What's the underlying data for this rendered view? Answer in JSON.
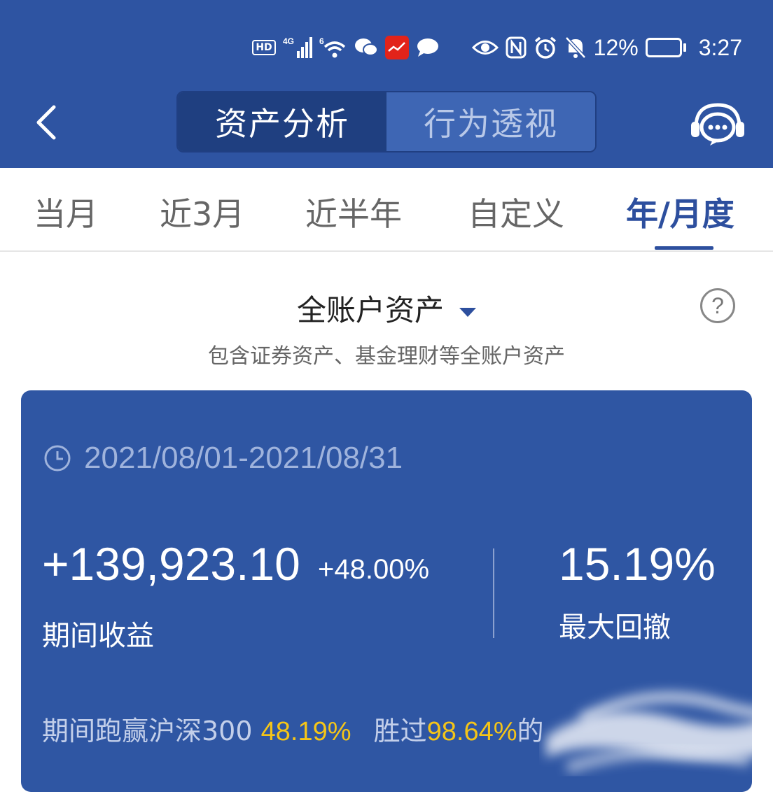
{
  "status_bar": {
    "hd": "HD",
    "network": "4G",
    "wifi_gen": "6",
    "battery_percent": "12%",
    "time": "3:27",
    "battery_level": 0.12,
    "icons": [
      "hd-icon",
      "signal-icon",
      "wifi-icon",
      "wechat-icon",
      "app-icon",
      "message-icon",
      "eye-icon",
      "nfc-icon",
      "alarm-icon",
      "mute-icon",
      "battery-icon"
    ]
  },
  "header": {
    "tabs": [
      {
        "label": "资产分析",
        "active": true
      },
      {
        "label": "行为透视",
        "active": false
      }
    ],
    "back_icon": "chevron-left-icon",
    "service_icon": "customer-service-icon"
  },
  "period_tabs": [
    {
      "label": "当月",
      "active": false
    },
    {
      "label": "近3月",
      "active": false
    },
    {
      "label": "近半年",
      "active": false
    },
    {
      "label": "自定义",
      "active": false
    },
    {
      "label": "年/月度",
      "active": true
    }
  ],
  "account": {
    "title": "全账户资产",
    "subtitle": "包含证券资产、基金理财等全账户资产",
    "help_symbol": "?"
  },
  "card": {
    "date_range": "2021/08/01-2021/08/31",
    "profit_value": "+139,923.10",
    "profit_pct": "+48.00%",
    "profit_label": "期间收益",
    "drawdown_value": "15.19%",
    "drawdown_label": "最大回撤",
    "compare_prefix": "期间跑赢沪深300",
    "compare_value": "48.19%",
    "beat_prefix": "胜过",
    "beat_value": "98.64%",
    "beat_suffix": "的"
  },
  "colors": {
    "header_bg": "#2e54a2",
    "card_bg": "#2f56a3",
    "accent": "#2d4f9e",
    "highlight": "#f5c518"
  }
}
